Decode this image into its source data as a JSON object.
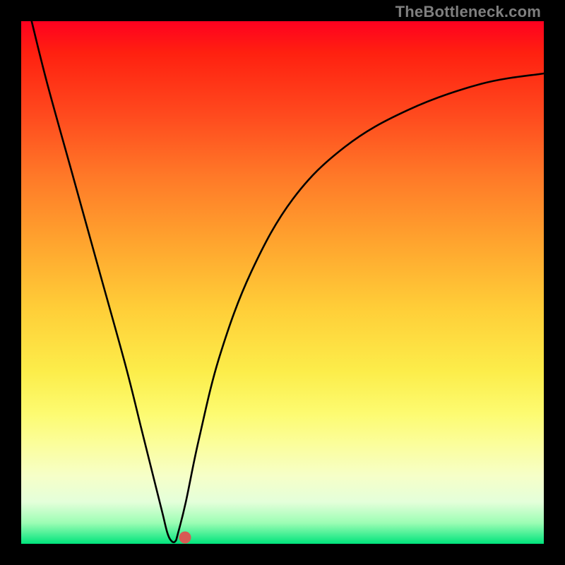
{
  "watermark": "TheBottleneck.com",
  "chart_data": {
    "type": "line",
    "title": "",
    "xlabel": "",
    "ylabel": "",
    "xlim": [
      0,
      100
    ],
    "ylim": [
      0,
      100
    ],
    "series": [
      {
        "name": "curve",
        "x": [
          2,
          5,
          10,
          15,
          20,
          23,
          25,
          27,
          28,
          28.8,
          29.5,
          30,
          31.5,
          34,
          38,
          44,
          52,
          62,
          74,
          88,
          100
        ],
        "values": [
          100,
          88,
          70,
          52,
          34,
          22,
          14,
          6,
          2,
          0.5,
          0.5,
          2,
          8,
          20,
          36,
          52,
          66,
          76,
          83,
          88,
          90
        ]
      }
    ],
    "marker": {
      "x": 31.3,
      "y": 1.2
    },
    "grid": false,
    "legend": false,
    "background_gradient": {
      "top": "#ff0020",
      "bottom": "#00e47c",
      "stops": [
        "#ff0020",
        "#ff4a1e",
        "#ff7a28",
        "#ffa32e",
        "#ffce38",
        "#fced4a",
        "#fdfb70",
        "#fbfe9c",
        "#f6ffc8",
        "#9cfdb4",
        "#00e47c"
      ]
    }
  }
}
